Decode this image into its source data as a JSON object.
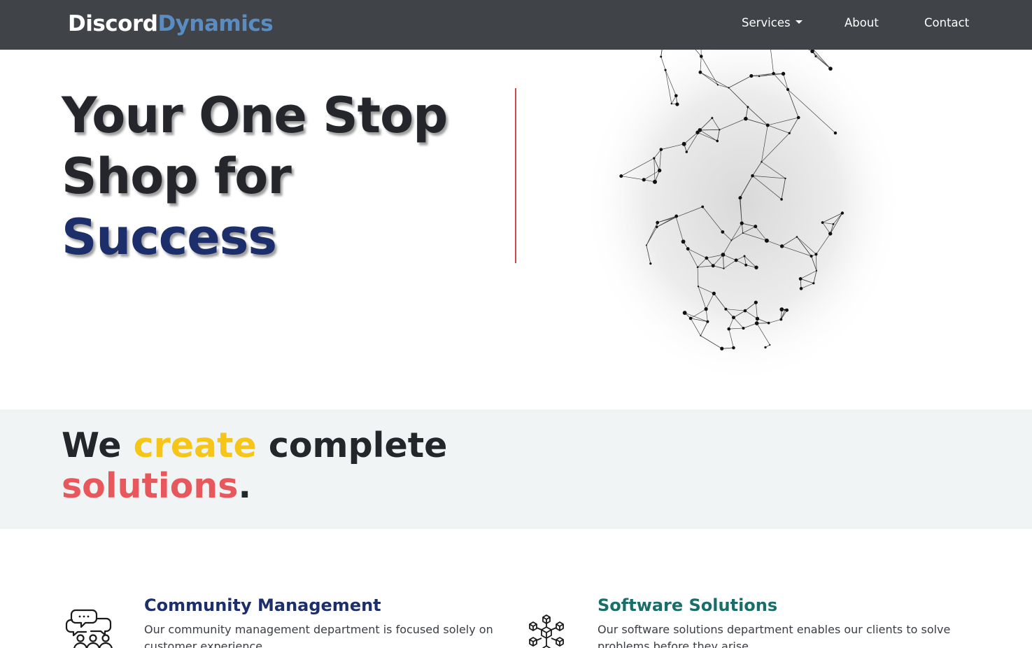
{
  "brand": {
    "part1": "Discord",
    "part2": "Dynamics"
  },
  "nav": {
    "services": "Services",
    "about": "About",
    "contact": "Contact"
  },
  "hero": {
    "line1": "Your One Stop",
    "line2": "Shop for",
    "line3": "Success"
  },
  "band": {
    "w1": "We",
    "w2": "create",
    "w3": "complete",
    "w4": "solutions",
    "w5": "."
  },
  "services": [
    {
      "title": "Community Management",
      "text": "Our community management department is focused solely on customer experience."
    },
    {
      "title": "Software Solutions",
      "text": "Our software solutions department enables our clients to solve problems before they arise."
    }
  ],
  "colors": {
    "nav_bg": "#404348",
    "brand_accent": "#5a8cc4",
    "hero_accent": "#1c2f6b",
    "divider": "#c94a4a",
    "yellow": "#f5c518",
    "red": "#e8575b",
    "teal": "#1a6e6a",
    "band_bg": "#f1f4f5"
  },
  "icons": {
    "community": "chat-people-icon",
    "software": "blockchain-cubes-icon",
    "caret": "chevron-down-icon"
  }
}
